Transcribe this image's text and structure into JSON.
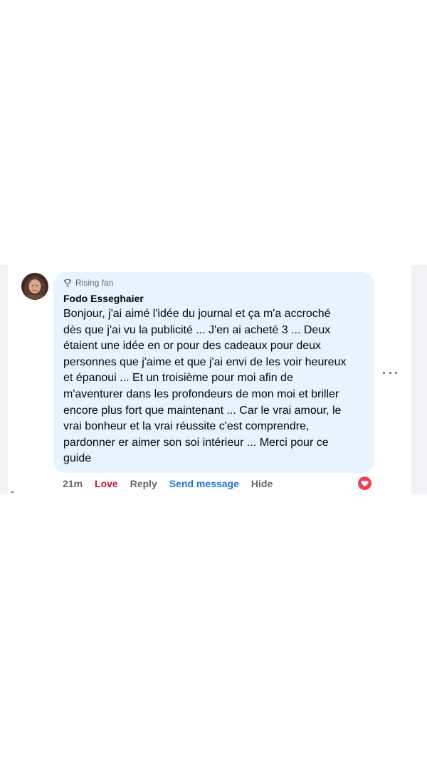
{
  "comment": {
    "badge": "Rising fan",
    "badge_icon": "trophy-icon",
    "author": "Fodo Esseghaier",
    "text": "Bonjour, j'ai aimé l'idée du journal et ça m'a accroché\ndès que j'ai vu la publicité ... J'en ai acheté 3 ... Deux\nétaient une idée en or pour des cadeaux pour deux\npersonnes que j'aime et que j'ai envi de les voir heureux\net épanoui ... Et un troisième pour moi afin de\nm'aventurer dans les profondeurs de mon moi et briller\nencore plus fort que maintenant ... Car le vrai amour, le\nvrai bonheur et la vrai réussite c'est comprendre,\npardonner er aimer son soi intérieur ... Merci pour ce\nguide",
    "bubble_color": "#e7f3ff"
  },
  "actions": {
    "time": "21m",
    "love": "Love",
    "reply": "Reply",
    "send_message": "Send message",
    "hide": "Hide",
    "love_color": "#c5152f",
    "send_color": "#1b74e4"
  },
  "reaction": {
    "icon": "heart-reaction-icon",
    "color": "#f33e58"
  },
  "menu": {
    "icon": "more-options-icon"
  }
}
